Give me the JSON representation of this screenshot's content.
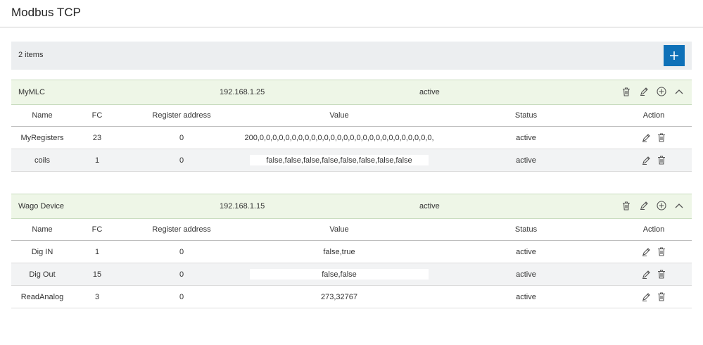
{
  "page": {
    "title": "Modbus TCP"
  },
  "toolbar": {
    "count": "2 items",
    "add_icon": "plus-icon"
  },
  "columns": {
    "name": "Name",
    "fc": "FC",
    "register": "Register address",
    "value": "Value",
    "status": "Status",
    "action": "Action"
  },
  "devices": [
    {
      "name": "MyMLC",
      "ip": "192.168.1.25",
      "status": "active",
      "rows": [
        {
          "name": "MyRegisters",
          "fc": "23",
          "register": "0",
          "value": "200,0,0,0,0,0,0,0,0,0,0,0,0,0,0,0,0,0,0,0,0,0,0,0,0,0,0,0,",
          "status": "active"
        },
        {
          "name": "coils",
          "fc": "1",
          "register": "0",
          "value": "false,false,false,false,false,false,false,false",
          "status": "active"
        }
      ]
    },
    {
      "name": "Wago Device",
      "ip": "192.168.1.15",
      "status": "active",
      "rows": [
        {
          "name": "Dig IN",
          "fc": "1",
          "register": "0",
          "value": "false,true",
          "status": "active"
        },
        {
          "name": "Dig Out",
          "fc": "15",
          "register": "0",
          "value": "false,false",
          "status": "active"
        },
        {
          "name": "ReadAnalog",
          "fc": "3",
          "register": "0",
          "value": "273,32767",
          "status": "active"
        }
      ]
    }
  ],
  "colors": {
    "accent": "#0f71b8",
    "device_header_bg": "#eef6e7",
    "toolbar_bg": "#eceef0",
    "alt_row_bg": "#f2f3f4"
  }
}
